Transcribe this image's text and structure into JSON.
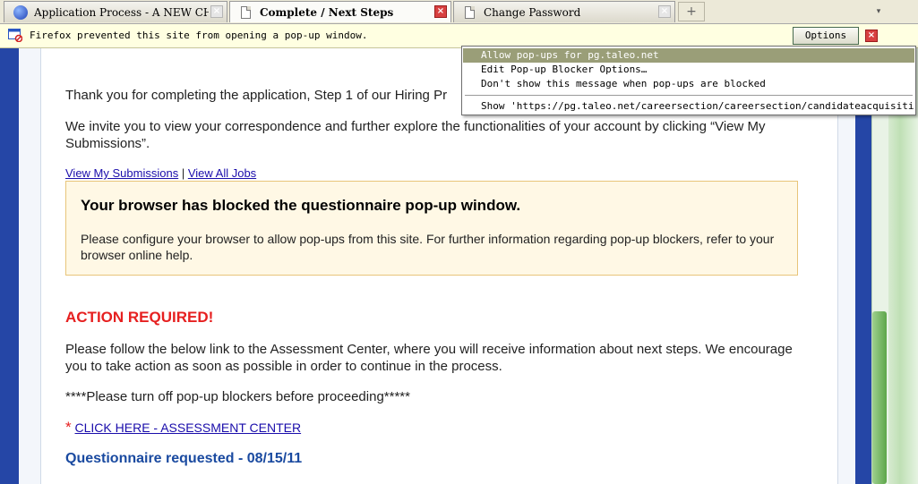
{
  "tabs": [
    {
      "title": "Application Process - A NEW CHA…",
      "icon": "globe-icon",
      "active": false
    },
    {
      "title": "Complete / Next Steps",
      "icon": "document-icon",
      "active": true
    },
    {
      "title": "Change Password",
      "icon": "document-icon",
      "active": false
    }
  ],
  "tabbar": {
    "new_tab": "+",
    "list_all": "▾"
  },
  "notification": {
    "message": "Firefox prevented this site from opening a pop-up window.",
    "options_label": "Options",
    "close_label": "×"
  },
  "menu": {
    "items": [
      "Allow pop-ups for pg.taleo.net",
      "Edit Pop-up Blocker Options…",
      "Don't show this message when pop-ups are blocked",
      "Show 'https://pg.taleo.net/careersection/careersection/candidateacquisiti…"
    ]
  },
  "page": {
    "p1": "Thank you for completing the application, Step 1 of our Hiring Pr",
    "p2": "We invite you to view your correspondence and further explore the functionalities of your account by clicking “View My Submissions”.",
    "link_submissions": "View My Submissions",
    "link_separator": " | ",
    "link_jobs": "View All Jobs",
    "warning_title": "Your browser has blocked the questionnaire pop-up window.",
    "warning_body": "Please configure your browser to allow pop-ups from this site. For further information regarding pop-up blockers, refer to your browser online help.",
    "action_title": "ACTION REQUIRED!",
    "p3": "Please follow the below link to the Assessment Center, where you will receive information about next steps. We encourage you to take action as soon as possible in order to continue in the process.",
    "p4": "****Please turn off pop-up blockers before proceeding*****",
    "cta_star": "*",
    "cta_link": "CLICK HERE - ASSESSMENT CENTER",
    "questionnaire": "Questionnaire requested - 08/15/11"
  },
  "colors": {
    "accent_blue": "#2546a6",
    "warning_bg": "#fff8e5",
    "action_red": "#e62020",
    "scroll_green": "#5da64a"
  }
}
